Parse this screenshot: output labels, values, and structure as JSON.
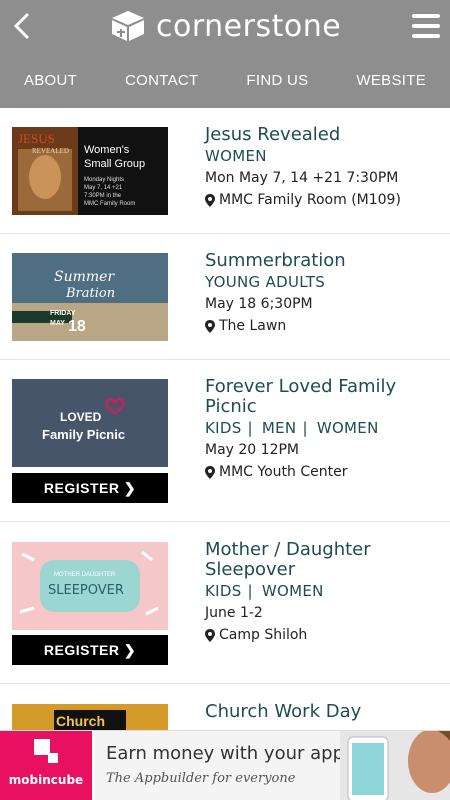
{
  "app": {
    "brand_name": "cornerstone",
    "back_icon": "chevron-left-icon",
    "menu_icon": "hamburger-menu-icon"
  },
  "nav": [
    {
      "label": "ABOUT"
    },
    {
      "label": "CONTACT"
    },
    {
      "label": "FIND US"
    },
    {
      "label": "WEBSITE"
    }
  ],
  "colors": {
    "header_bg": "#8e8e8e",
    "title_color": "#1f4d4d",
    "register_bg": "#000000",
    "ad_brand": "#e8115f"
  },
  "events": [
    {
      "title": "Jesus Revealed",
      "categories": [
        "WOMEN"
      ],
      "date": "Mon May 7, 14 +21 7:30PM",
      "location": "MMC Family Room (M109)",
      "image": {
        "heading1": "JESUS",
        "heading2": "REVEALED",
        "line1": "Women's",
        "line2": "Small Group",
        "details1": "Monday Nights",
        "details2": "May 7, 14 +21",
        "details3": "7:30PM in the",
        "details4": "MMC Family Room"
      }
    },
    {
      "title": "Summerbration",
      "categories": [
        "YOUNG ADULTS"
      ],
      "date": "May 18 6;30PM",
      "location": "The Lawn",
      "image": {
        "word1": "Summer",
        "word2": "Bration",
        "day": "FRIDAY",
        "month": "MAY",
        "daynum": "18"
      }
    },
    {
      "title": "Forever Loved Family Picnic",
      "title_line1": "Forever Loved Family",
      "title_line2": "Picnic",
      "categories": [
        "KIDS",
        "MEN",
        "WOMEN"
      ],
      "date": "May 20 12PM",
      "location": "MMC Youth Center",
      "register": "REGISTER",
      "image": {
        "word1": "LOVED",
        "word2": "Family Picnic"
      }
    },
    {
      "title": "Mother / Daughter Sleepover",
      "title_line1": "Mother / Daughter",
      "title_line2": "Sleepover",
      "categories": [
        "KIDS",
        "WOMEN"
      ],
      "date": "June 1-2",
      "location": "Camp Shiloh",
      "register": "REGISTER",
      "image": {
        "word1": "MOTHER DAUGHTER",
        "word2": "SLEEPOVER"
      }
    },
    {
      "title": "Church Work Day",
      "image": {
        "word1": "Church"
      }
    }
  ],
  "ad": {
    "brand": "mobincube",
    "headline": "Earn money with your apps",
    "subline": "The Appbuilder for everyone"
  }
}
